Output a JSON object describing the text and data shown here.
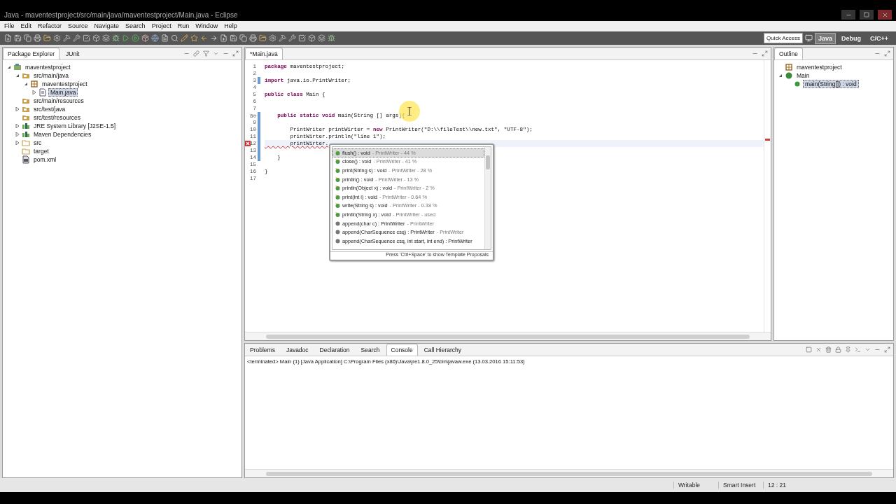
{
  "window": {
    "title": "Java - maventestproject/src/main/java/maventestproject/Main.java - Eclipse"
  },
  "menu": [
    "File",
    "Edit",
    "Refactor",
    "Source",
    "Navigate",
    "Search",
    "Project",
    "Run",
    "Window",
    "Help"
  ],
  "quick_access": {
    "placeholder": "Quick Access"
  },
  "perspectives": [
    {
      "label": "Java",
      "selected": true
    },
    {
      "label": "Debug",
      "selected": false
    },
    {
      "label": "C/C++",
      "selected": false
    }
  ],
  "left_panel": {
    "tabs": [
      {
        "label": "Package Explorer",
        "selected": true
      },
      {
        "label": "JUnit",
        "selected": false
      }
    ],
    "tree": [
      {
        "label": "maventestproject",
        "kind": "project",
        "expanded": true,
        "selected": false,
        "children": [
          {
            "label": "src/main/java",
            "kind": "source-folder",
            "expanded": true,
            "selected": false,
            "children": [
              {
                "label": "maventestproject",
                "kind": "package",
                "expanded": true,
                "selected": false,
                "children": [
                  {
                    "label": "Main.java",
                    "kind": "java-file",
                    "expanded": false,
                    "selected": true
                  }
                ]
              }
            ]
          },
          {
            "label": "src/main/resources",
            "kind": "source-folder",
            "selected": false
          },
          {
            "label": "src/test/java",
            "kind": "source-folder",
            "expanded": false,
            "selected": false
          },
          {
            "label": "src/test/resources",
            "kind": "source-folder",
            "selected": false
          },
          {
            "label": "JRE System Library [J2SE-1.5]",
            "kind": "library",
            "expanded": false,
            "selected": false
          },
          {
            "label": "Maven Dependencies",
            "kind": "library",
            "expanded": false,
            "selected": false
          },
          {
            "label": "src",
            "kind": "folder",
            "expanded": false,
            "selected": false
          },
          {
            "label": "target",
            "kind": "folder",
            "selected": false
          },
          {
            "label": "pom.xml",
            "kind": "xml-file",
            "selected": false
          }
        ]
      }
    ]
  },
  "editor": {
    "tab": "*Main.java",
    "lines": [
      {
        "number": "1",
        "text": "**package** maventestproject;",
        "changed": false,
        "current": false,
        "error": false
      },
      {
        "number": "2",
        "changed": false,
        "current": false,
        "error": false
      },
      {
        "number": "3",
        "text": "**import** java.io.PrintWriter;",
        "changed": true,
        "current": false,
        "error": false
      },
      {
        "number": "4",
        "changed": false,
        "current": false,
        "error": false
      },
      {
        "number": "5",
        "text": "**public** **class** Main {",
        "changed": false,
        "current": false,
        "error": false
      },
      {
        "number": "6",
        "changed": false,
        "current": false,
        "error": false
      },
      {
        "number": "7",
        "changed": false,
        "current": false,
        "error": false
      },
      {
        "number": "8⊖",
        "text": "    **public** **static** **void** main(String [] args){",
        "changed": true,
        "current": false,
        "error": false
      },
      {
        "number": "9",
        "changed": true,
        "current": false,
        "error": false
      },
      {
        "number": "10",
        "text": "        PrintWriter printWirter = **new** PrintWriter(\"D:\\\\fileTest\\\\new.txt\", \"UTF-8\");",
        "changed": true,
        "current": false,
        "error": false
      },
      {
        "number": "11",
        "text": "        printWirter.println(\"line 1\");",
        "changed": true,
        "current": false,
        "error": false
      },
      {
        "number": "12",
        "text": "        printWirter.",
        "changed": true,
        "current": true,
        "error": true
      },
      {
        "number": "13",
        "changed": true,
        "current": false,
        "error": false
      },
      {
        "number": "14",
        "text": "    }",
        "changed": true,
        "current": false,
        "error": false
      },
      {
        "number": "15",
        "changed": false,
        "current": false,
        "error": false
      },
      {
        "number": "16",
        "text": "}",
        "changed": false,
        "current": false,
        "error": false
      },
      {
        "number": "17",
        "changed": false,
        "current": false,
        "error": false
      }
    ]
  },
  "completion": {
    "items": [
      {
        "signature": "flush() : void",
        "detail": "- PrintWriter - 44 %",
        "kind": "recommended",
        "selected": true
      },
      {
        "signature": "close() : void",
        "detail": "- PrintWriter - 41 %",
        "kind": "recommended",
        "selected": false
      },
      {
        "signature": "print(String s) : void",
        "detail": "- PrintWriter - 28 %",
        "kind": "recommended",
        "selected": false
      },
      {
        "signature": "println() : void",
        "detail": "- PrintWriter - 13 %",
        "kind": "recommended",
        "selected": false
      },
      {
        "signature": "println(Object x) : void",
        "detail": "- PrintWriter - 2 %",
        "kind": "recommended",
        "selected": false
      },
      {
        "signature": "print(int i) : void",
        "detail": "- PrintWriter - 0.64 %",
        "kind": "recommended",
        "selected": false
      },
      {
        "signature": "write(String s) : void",
        "detail": "- PrintWriter - 0.38 %",
        "kind": "recommended",
        "selected": false
      },
      {
        "signature": "println(String x) : void",
        "detail": "- PrintWriter - used",
        "kind": "recommended",
        "selected": false
      },
      {
        "signature": "append(char c) : PrintWriter",
        "detail": "- PrintWriter",
        "kind": "method",
        "selected": false
      },
      {
        "signature": "append(CharSequence csq) : PrintWriter",
        "detail": "- PrintWriter",
        "kind": "method",
        "selected": false
      },
      {
        "signature": "append(CharSequence csq, int start, int end) : PrintWriter",
        "kind": "method",
        "selected": false
      }
    ],
    "footer": "Press 'Ctrl+Space' to show Template Proposals"
  },
  "outline": {
    "tab": "Outline",
    "tree": [
      {
        "label": "maventestproject",
        "kind": "package",
        "selected": false
      },
      {
        "label": "Main",
        "kind": "class",
        "expanded": true,
        "selected": false,
        "children": [
          {
            "label": "main(String[]) : void",
            "kind": "method",
            "selected": true
          }
        ]
      }
    ]
  },
  "bottom_panel": {
    "tabs": [
      {
        "label": "Problems",
        "selected": false
      },
      {
        "label": "Javadoc",
        "selected": false
      },
      {
        "label": "Declaration",
        "selected": false
      },
      {
        "label": "Search",
        "selected": false
      },
      {
        "label": "Console",
        "selected": true
      },
      {
        "label": "Call Hierarchy",
        "selected": false
      }
    ],
    "console_header": "<terminated> Main (1) [Java Application] C:\\Program Files (x86)\\Java\\jre1.8.0_25\\bin\\javaw.exe (13.03.2016 15:11:53)"
  },
  "status_bar": {
    "items": [
      "Writable",
      "Smart Insert",
      "12 : 21"
    ]
  }
}
